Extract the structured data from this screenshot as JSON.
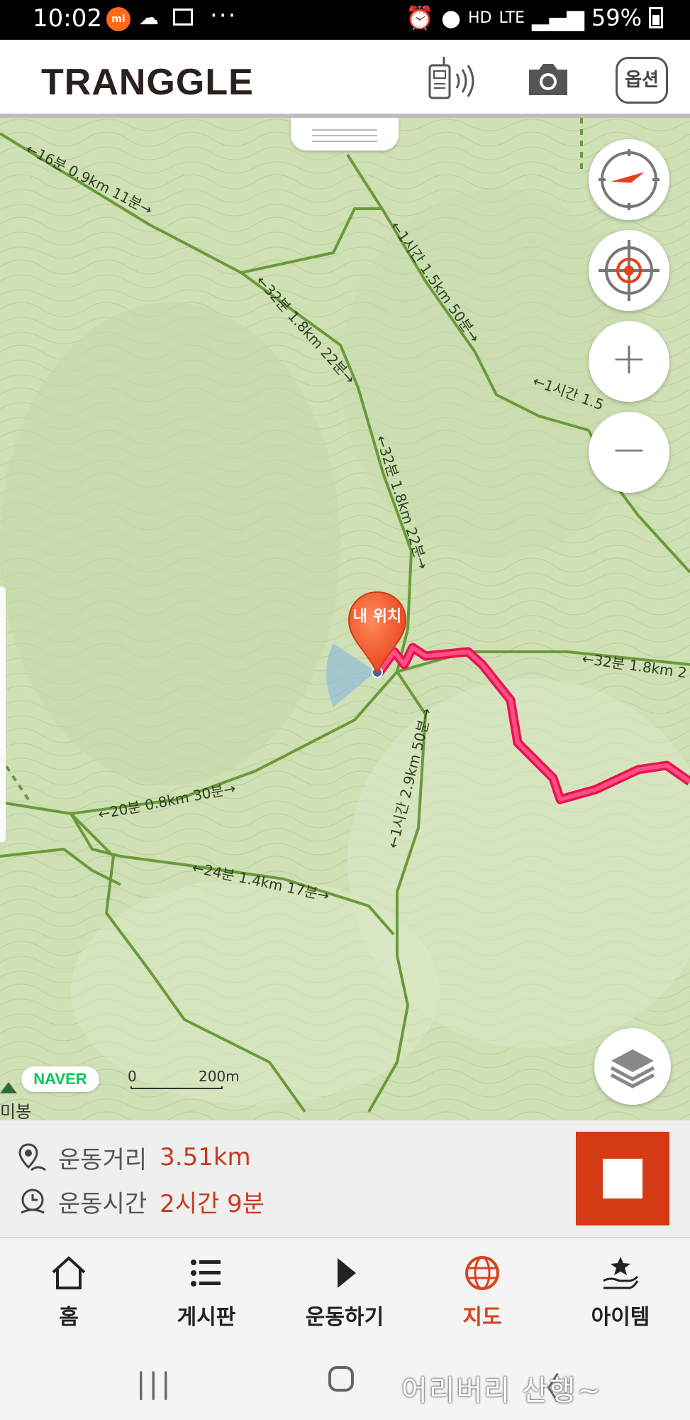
{
  "status_bar": {
    "time": "10:02",
    "app_badge": "mi",
    "dots": "···",
    "network": "HD",
    "lte": "LTE",
    "battery": "59%"
  },
  "header": {
    "logo": "TRANGGLE",
    "option_label": "옵션"
  },
  "map": {
    "pin_label": "내 위치",
    "trail_labels": [
      "←16분 0.9km 11분→",
      "←32분 1.8km 22분→",
      "←1시간 1.5km 50분→",
      "←1시간 1.5",
      "←32분 1.8km 22분→",
      "←32분 1.8km 2",
      "←20분 0.8km 30분→",
      "←1시간 2.9km 50분→",
      "←24분 1.4km 17분→"
    ],
    "naver_logo": "NAVER",
    "scale": {
      "start": "0",
      "end": "200m"
    },
    "peak_label": "미봉",
    "zoom_in": "+",
    "zoom_out": "−"
  },
  "stats": {
    "distance_label": "운동거리",
    "distance_value": "3.51km",
    "time_label": "운동시간",
    "time_value": "2시간 9분"
  },
  "nav": [
    {
      "label": "홈",
      "icon": "home-icon"
    },
    {
      "label": "게시판",
      "icon": "list-icon"
    },
    {
      "label": "운동하기",
      "icon": "play-icon"
    },
    {
      "label": "지도",
      "icon": "globe-icon",
      "active": true
    },
    {
      "label": "아이템",
      "icon": "star-hand-icon"
    }
  ],
  "system_nav": {
    "recent": "|||",
    "back": "〈",
    "watermark": "어리버리 산행~"
  },
  "colors": {
    "accent": "#d9431c",
    "track": "#ff2d6b",
    "trail": "#6a9a3a",
    "map_bg": "#cfe0b5"
  }
}
